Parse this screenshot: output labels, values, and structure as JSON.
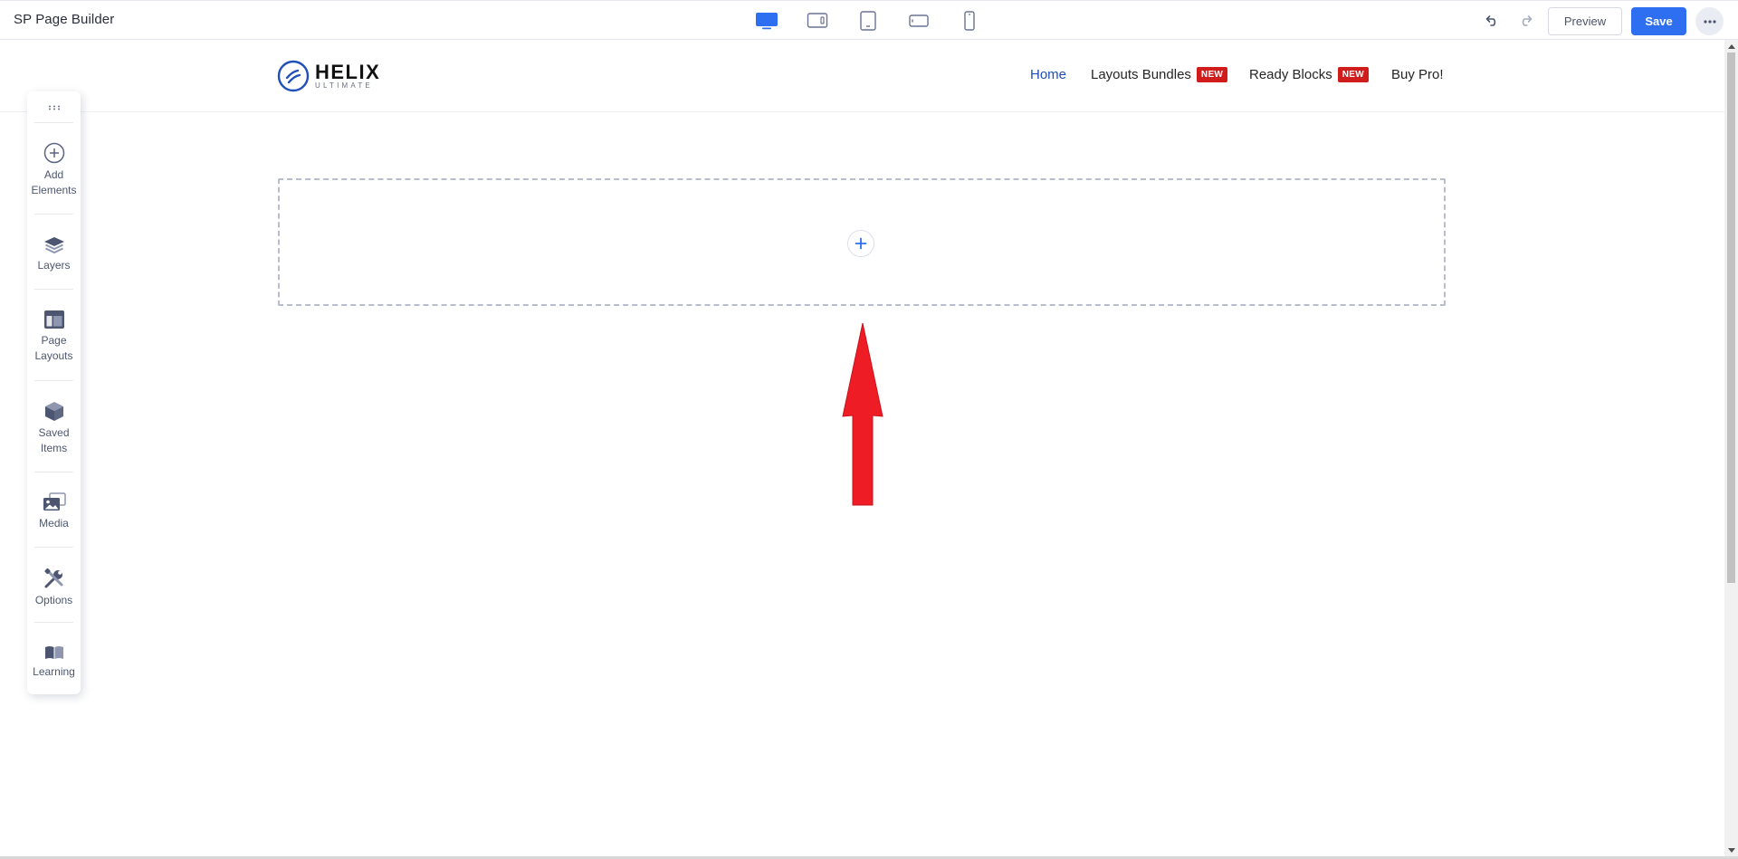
{
  "app": {
    "title": "SP Page Builder"
  },
  "toolbar": {
    "devices": [
      {
        "name": "desktop-icon",
        "active": true
      },
      {
        "name": "laptop-icon",
        "active": false
      },
      {
        "name": "tablet-icon",
        "active": false
      },
      {
        "name": "tablet-landscape-icon",
        "active": false
      },
      {
        "name": "mobile-icon",
        "active": false
      }
    ],
    "preview_label": "Preview",
    "save_label": "Save"
  },
  "site": {
    "logo": {
      "word": "HELIX",
      "sub": "ULTIMATE"
    },
    "nav": [
      {
        "label": "Home",
        "active": true,
        "badge": ""
      },
      {
        "label": "Layouts Bundles",
        "active": false,
        "badge": "NEW"
      },
      {
        "label": "Ready Blocks",
        "active": false,
        "badge": "NEW"
      },
      {
        "label": "Buy Pro!",
        "active": false,
        "badge": ""
      }
    ]
  },
  "tool_panel": {
    "items": [
      {
        "icon": "add-circle-icon",
        "label": "Add Elements"
      },
      {
        "icon": "layers-icon",
        "label": "Layers"
      },
      {
        "icon": "page-layout-icon",
        "label": "Page Layouts"
      },
      {
        "icon": "box-icon",
        "label": "Saved Items"
      },
      {
        "icon": "media-icon",
        "label": "Media"
      },
      {
        "icon": "wrench-screwdriver-icon",
        "label": "Options"
      },
      {
        "icon": "book-icon",
        "label": "Learning"
      }
    ]
  },
  "colors": {
    "accent": "#2d6ff0",
    "badge": "#d11c1c",
    "nav_active": "#1e4db7",
    "panel_icon": "#4c5670",
    "arrow": "#ee1c25"
  }
}
